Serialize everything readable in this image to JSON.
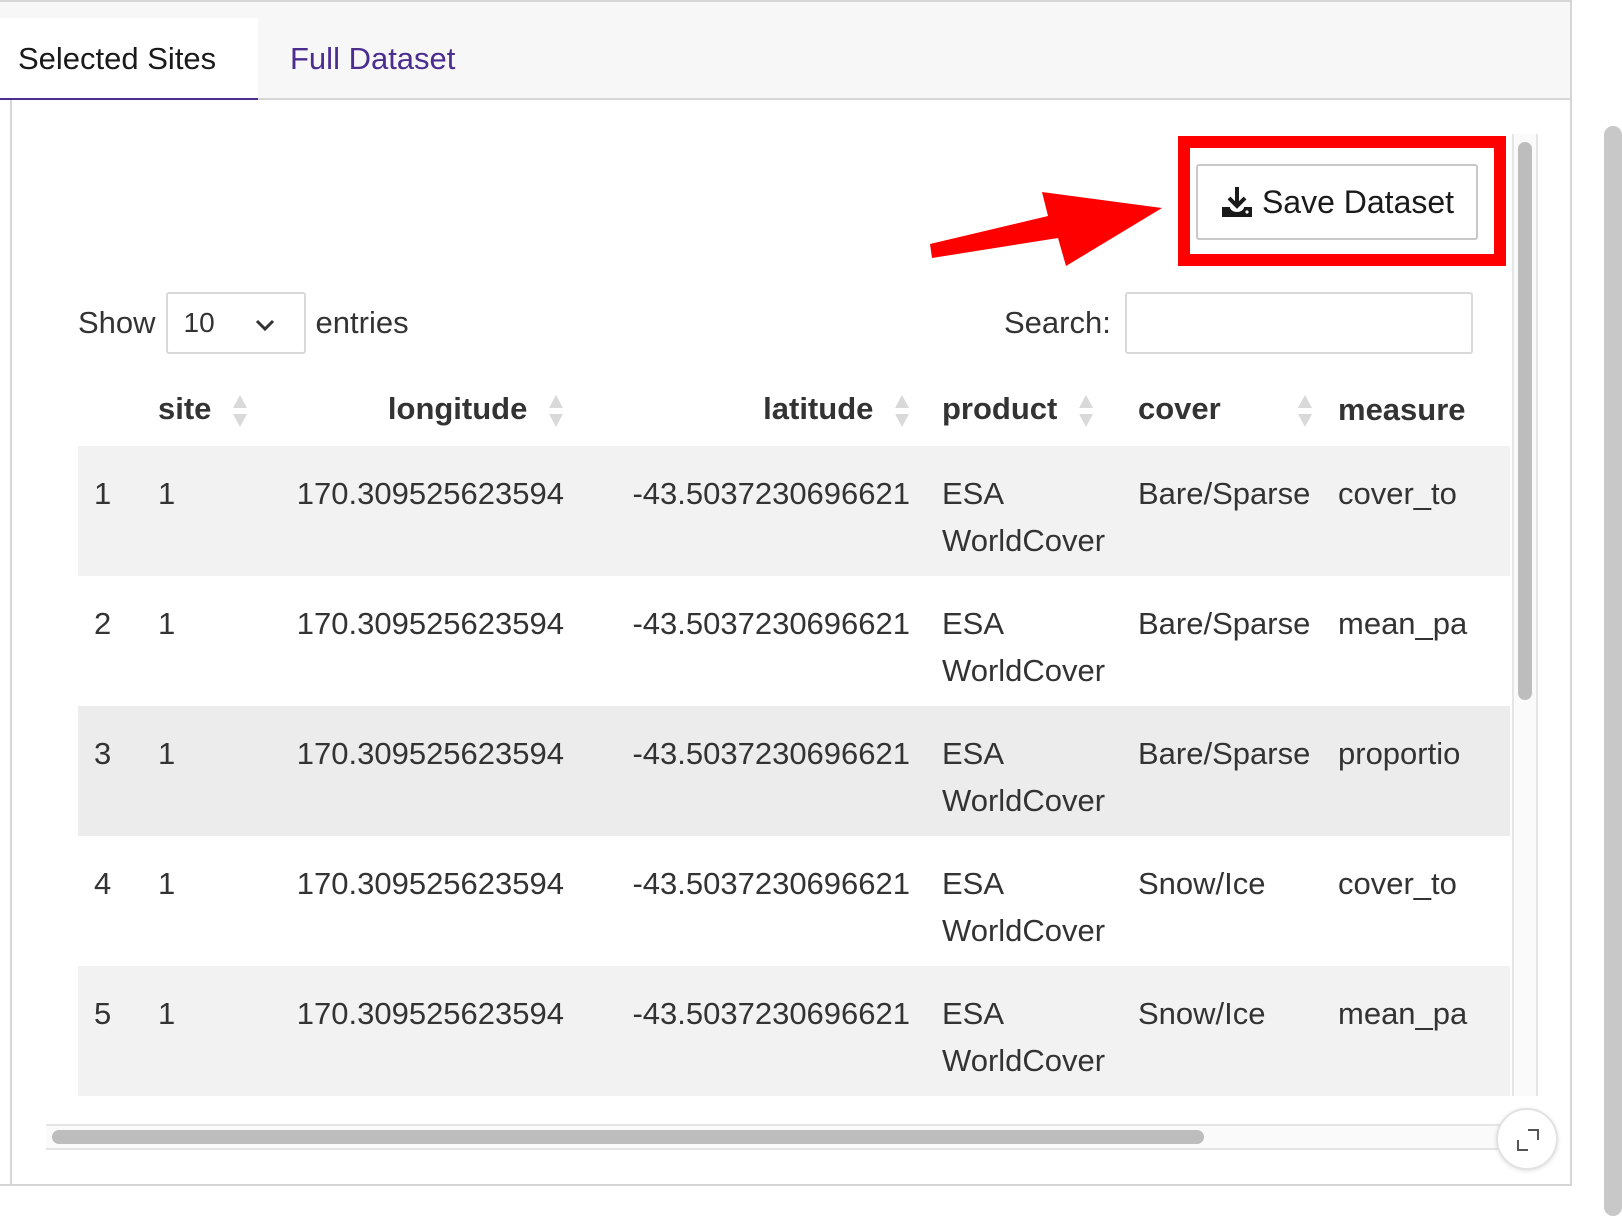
{
  "tabs": [
    {
      "label": "Selected Sites",
      "active": true
    },
    {
      "label": "Full Dataset",
      "active": false
    }
  ],
  "toolbar": {
    "save_label": "Save Dataset",
    "save_icon": "download-icon",
    "highlight_color": "#ff0000"
  },
  "length_control": {
    "prefix": "Show",
    "value": "10",
    "suffix": "entries"
  },
  "search": {
    "label": "Search:",
    "value": "",
    "placeholder": ""
  },
  "table": {
    "columns": [
      "",
      "site",
      "longitude",
      "latitude",
      "product",
      "cover",
      "measure"
    ],
    "rows": [
      {
        "index": "1",
        "site": "1",
        "longitude": "170.309525623594",
        "latitude": "-43.5037230696621",
        "product": "ESA WorldCover",
        "cover": "Bare/Sparse",
        "measure": "cover_to"
      },
      {
        "index": "2",
        "site": "1",
        "longitude": "170.309525623594",
        "latitude": "-43.5037230696621",
        "product": "ESA WorldCover",
        "cover": "Bare/Sparse",
        "measure": "mean_pa"
      },
      {
        "index": "3",
        "site": "1",
        "longitude": "170.309525623594",
        "latitude": "-43.5037230696621",
        "product": "ESA WorldCover",
        "cover": "Bare/Sparse",
        "measure": "proportio"
      },
      {
        "index": "4",
        "site": "1",
        "longitude": "170.309525623594",
        "latitude": "-43.5037230696621",
        "product": "ESA WorldCover",
        "cover": "Snow/Ice",
        "measure": "cover_to"
      },
      {
        "index": "5",
        "site": "1",
        "longitude": "170.309525623594",
        "latitude": "-43.5037230696621",
        "product": "ESA WorldCover",
        "cover": "Snow/Ice",
        "measure": "mean_pa"
      }
    ]
  },
  "colors": {
    "accent": "#4a2d8f",
    "odd_row": "#f2f2f2",
    "annotation": "#ff0000"
  }
}
